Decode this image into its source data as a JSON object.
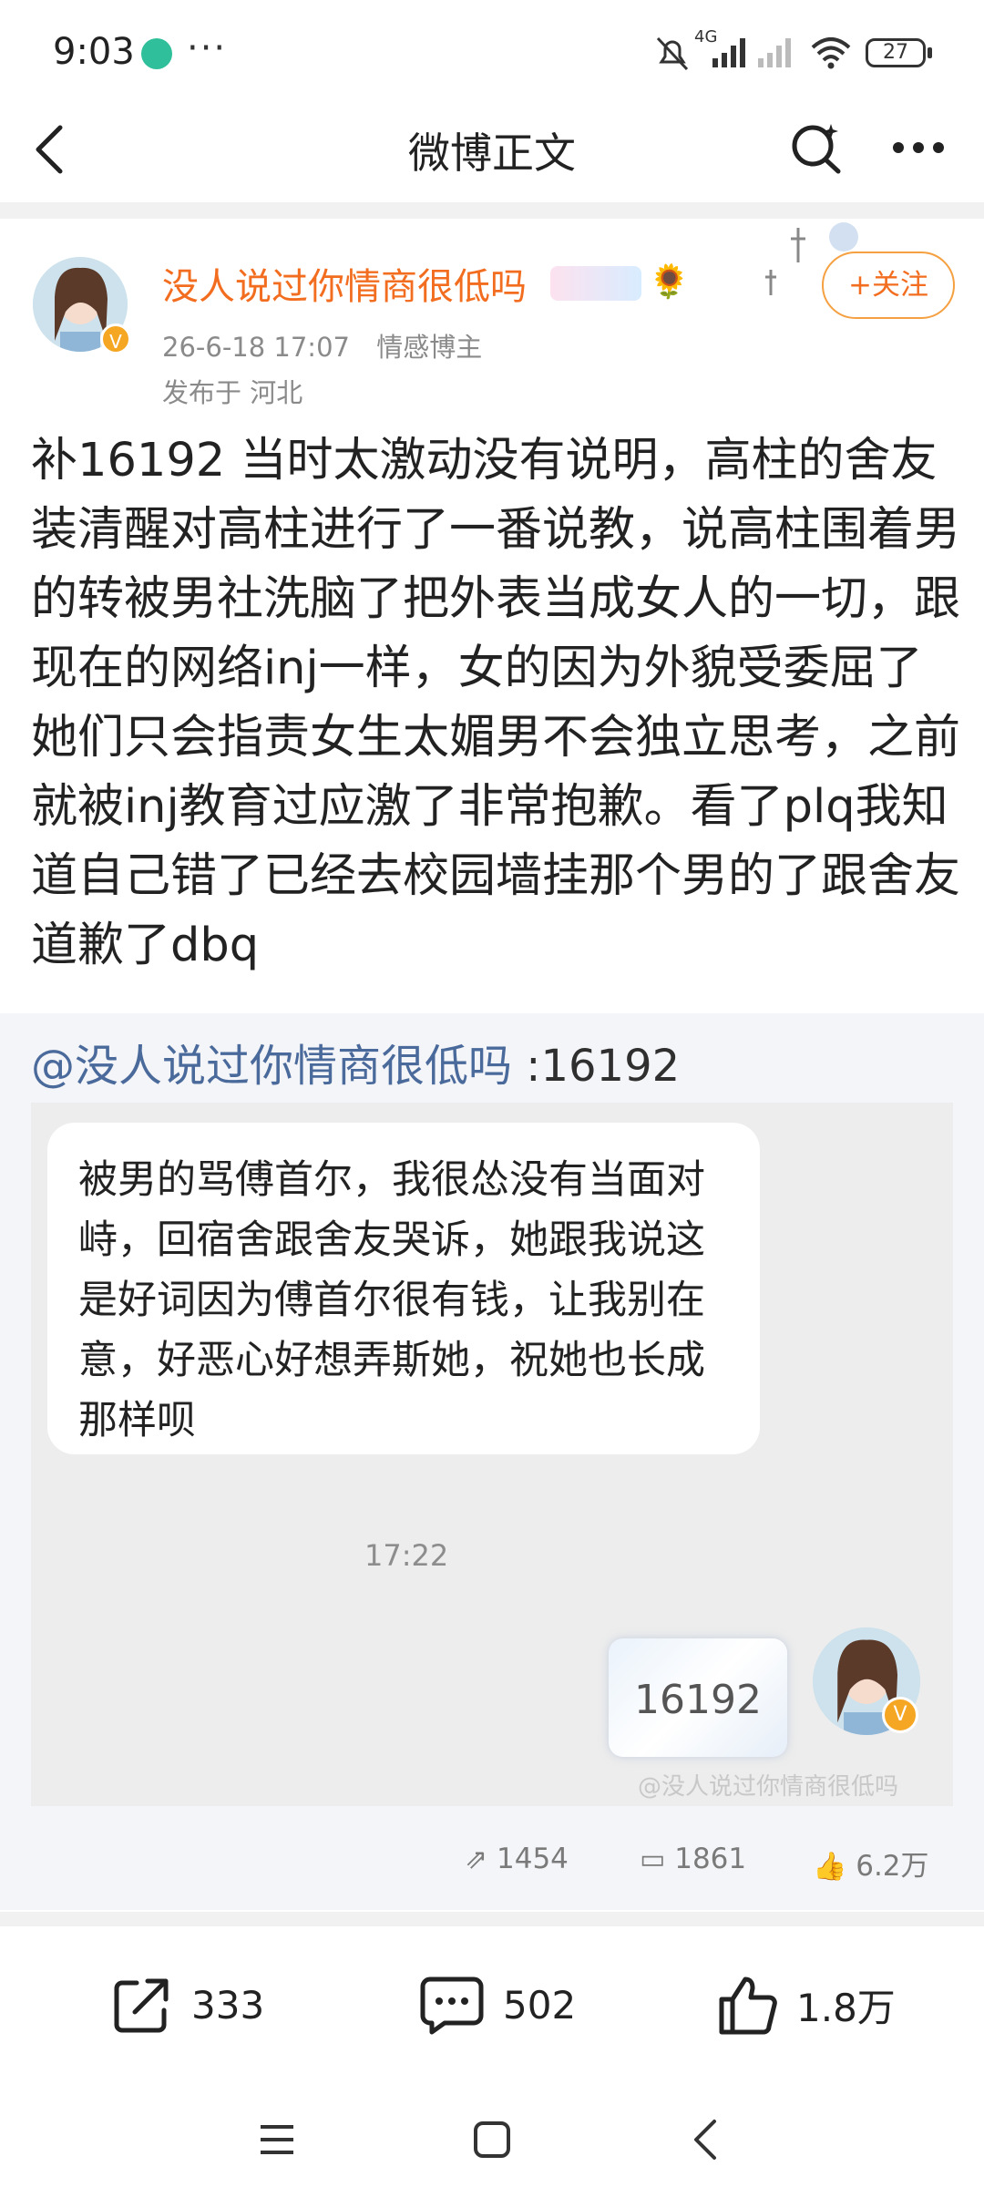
{
  "status_bar": {
    "time": "9:03",
    "more": "···",
    "battery": "27",
    "network_label": "4G"
  },
  "nav": {
    "title": "微博正文"
  },
  "author": {
    "name": "没人说过你情商很低吗",
    "time": "26-6-18 17:07",
    "role": "情感博主",
    "location": "发布于 河北",
    "follow_label": "+关注"
  },
  "post": {
    "text": "补16192 当时太激动没有说明，高柱的舍友装清醒对高柱进行了一番说教，说高柱围着男的转被男社洗脑了把外表当成女人的一切，跟现在的网络inj一样，女的因为外貌受委屈了她们只会指责女生太媚男不会独立思考，之前就被inj教育过应激了非常抱歉。看了plq我知道自己错了已经去校园墙挂那个男的了跟舍友道歉了dbq"
  },
  "repost": {
    "mention": "@没人说过你情商很低吗",
    "suffix": " :16192",
    "chat_message": "被男的骂傅首尔，我很怂没有当面对峙，回宿舍跟舍友哭诉，她跟我说这是好词因为傅首尔很有钱，让我别在意，好恶心好想弄斯她，祝她也长成那样呗",
    "chat_time": "17:22",
    "card_number": "16192",
    "watermark": "@没人说过你情商很低吗",
    "stats": {
      "reposts": "1454",
      "comments": "1861",
      "likes": "6.2万"
    }
  },
  "actions": {
    "repost": "333",
    "comment": "502",
    "like": "1.8万"
  },
  "colors": {
    "accent": "#f26d1f",
    "mention": "#4a6a9b",
    "muted": "#8a8a8a"
  }
}
